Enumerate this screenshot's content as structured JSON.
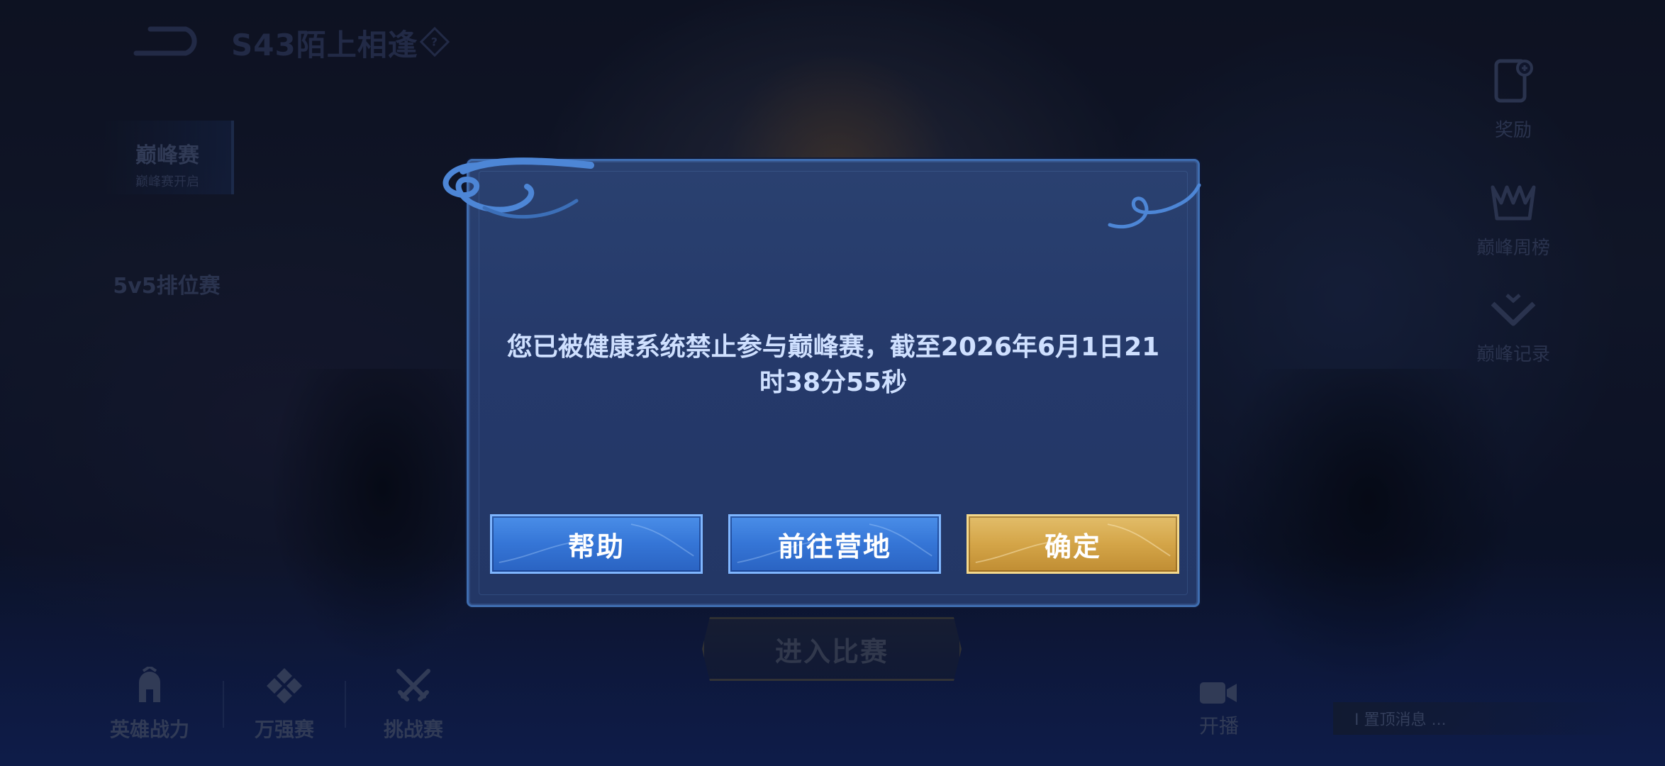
{
  "header": {
    "season_title": "S43陌上相逢",
    "help_symbol": "?"
  },
  "left_menu": {
    "peak": {
      "label": "巅峰赛",
      "sub": "巅峰赛开启"
    },
    "rank": {
      "label": "5v5排位赛"
    }
  },
  "right_menu": {
    "rewards": {
      "label": "奖励",
      "icon": "reward-card-icon"
    },
    "weekly": {
      "label": "巅峰周榜",
      "icon": "crown-icon"
    },
    "records": {
      "label": "巅峰记录",
      "icon": "chevron-down-icon"
    }
  },
  "bottom_bar": {
    "hero_power": {
      "label": "英雄战力",
      "icon": "helmet-icon"
    },
    "tournament": {
      "label": "万强赛",
      "icon": "diamond-grid-icon"
    },
    "challenge": {
      "label": "挑战赛",
      "icon": "crossed-swords-icon"
    },
    "broadcast": {
      "label": "开播",
      "icon": "camera-icon"
    },
    "enter_match": "进入比赛",
    "notice": "I 置顶消息 ..."
  },
  "dialog": {
    "message": "您已被健康系统禁止参与巅峰赛，截至2026年6月1日21时38分55秒",
    "buttons": {
      "help": "帮助",
      "camp": "前往营地",
      "confirm": "确定"
    }
  },
  "colors": {
    "dialog_bg": "#25396a",
    "dialog_border": "#3f6db0",
    "blue_button": "#3575d6",
    "gold_button": "#d4a548",
    "message_text": "#cfe0ff"
  }
}
